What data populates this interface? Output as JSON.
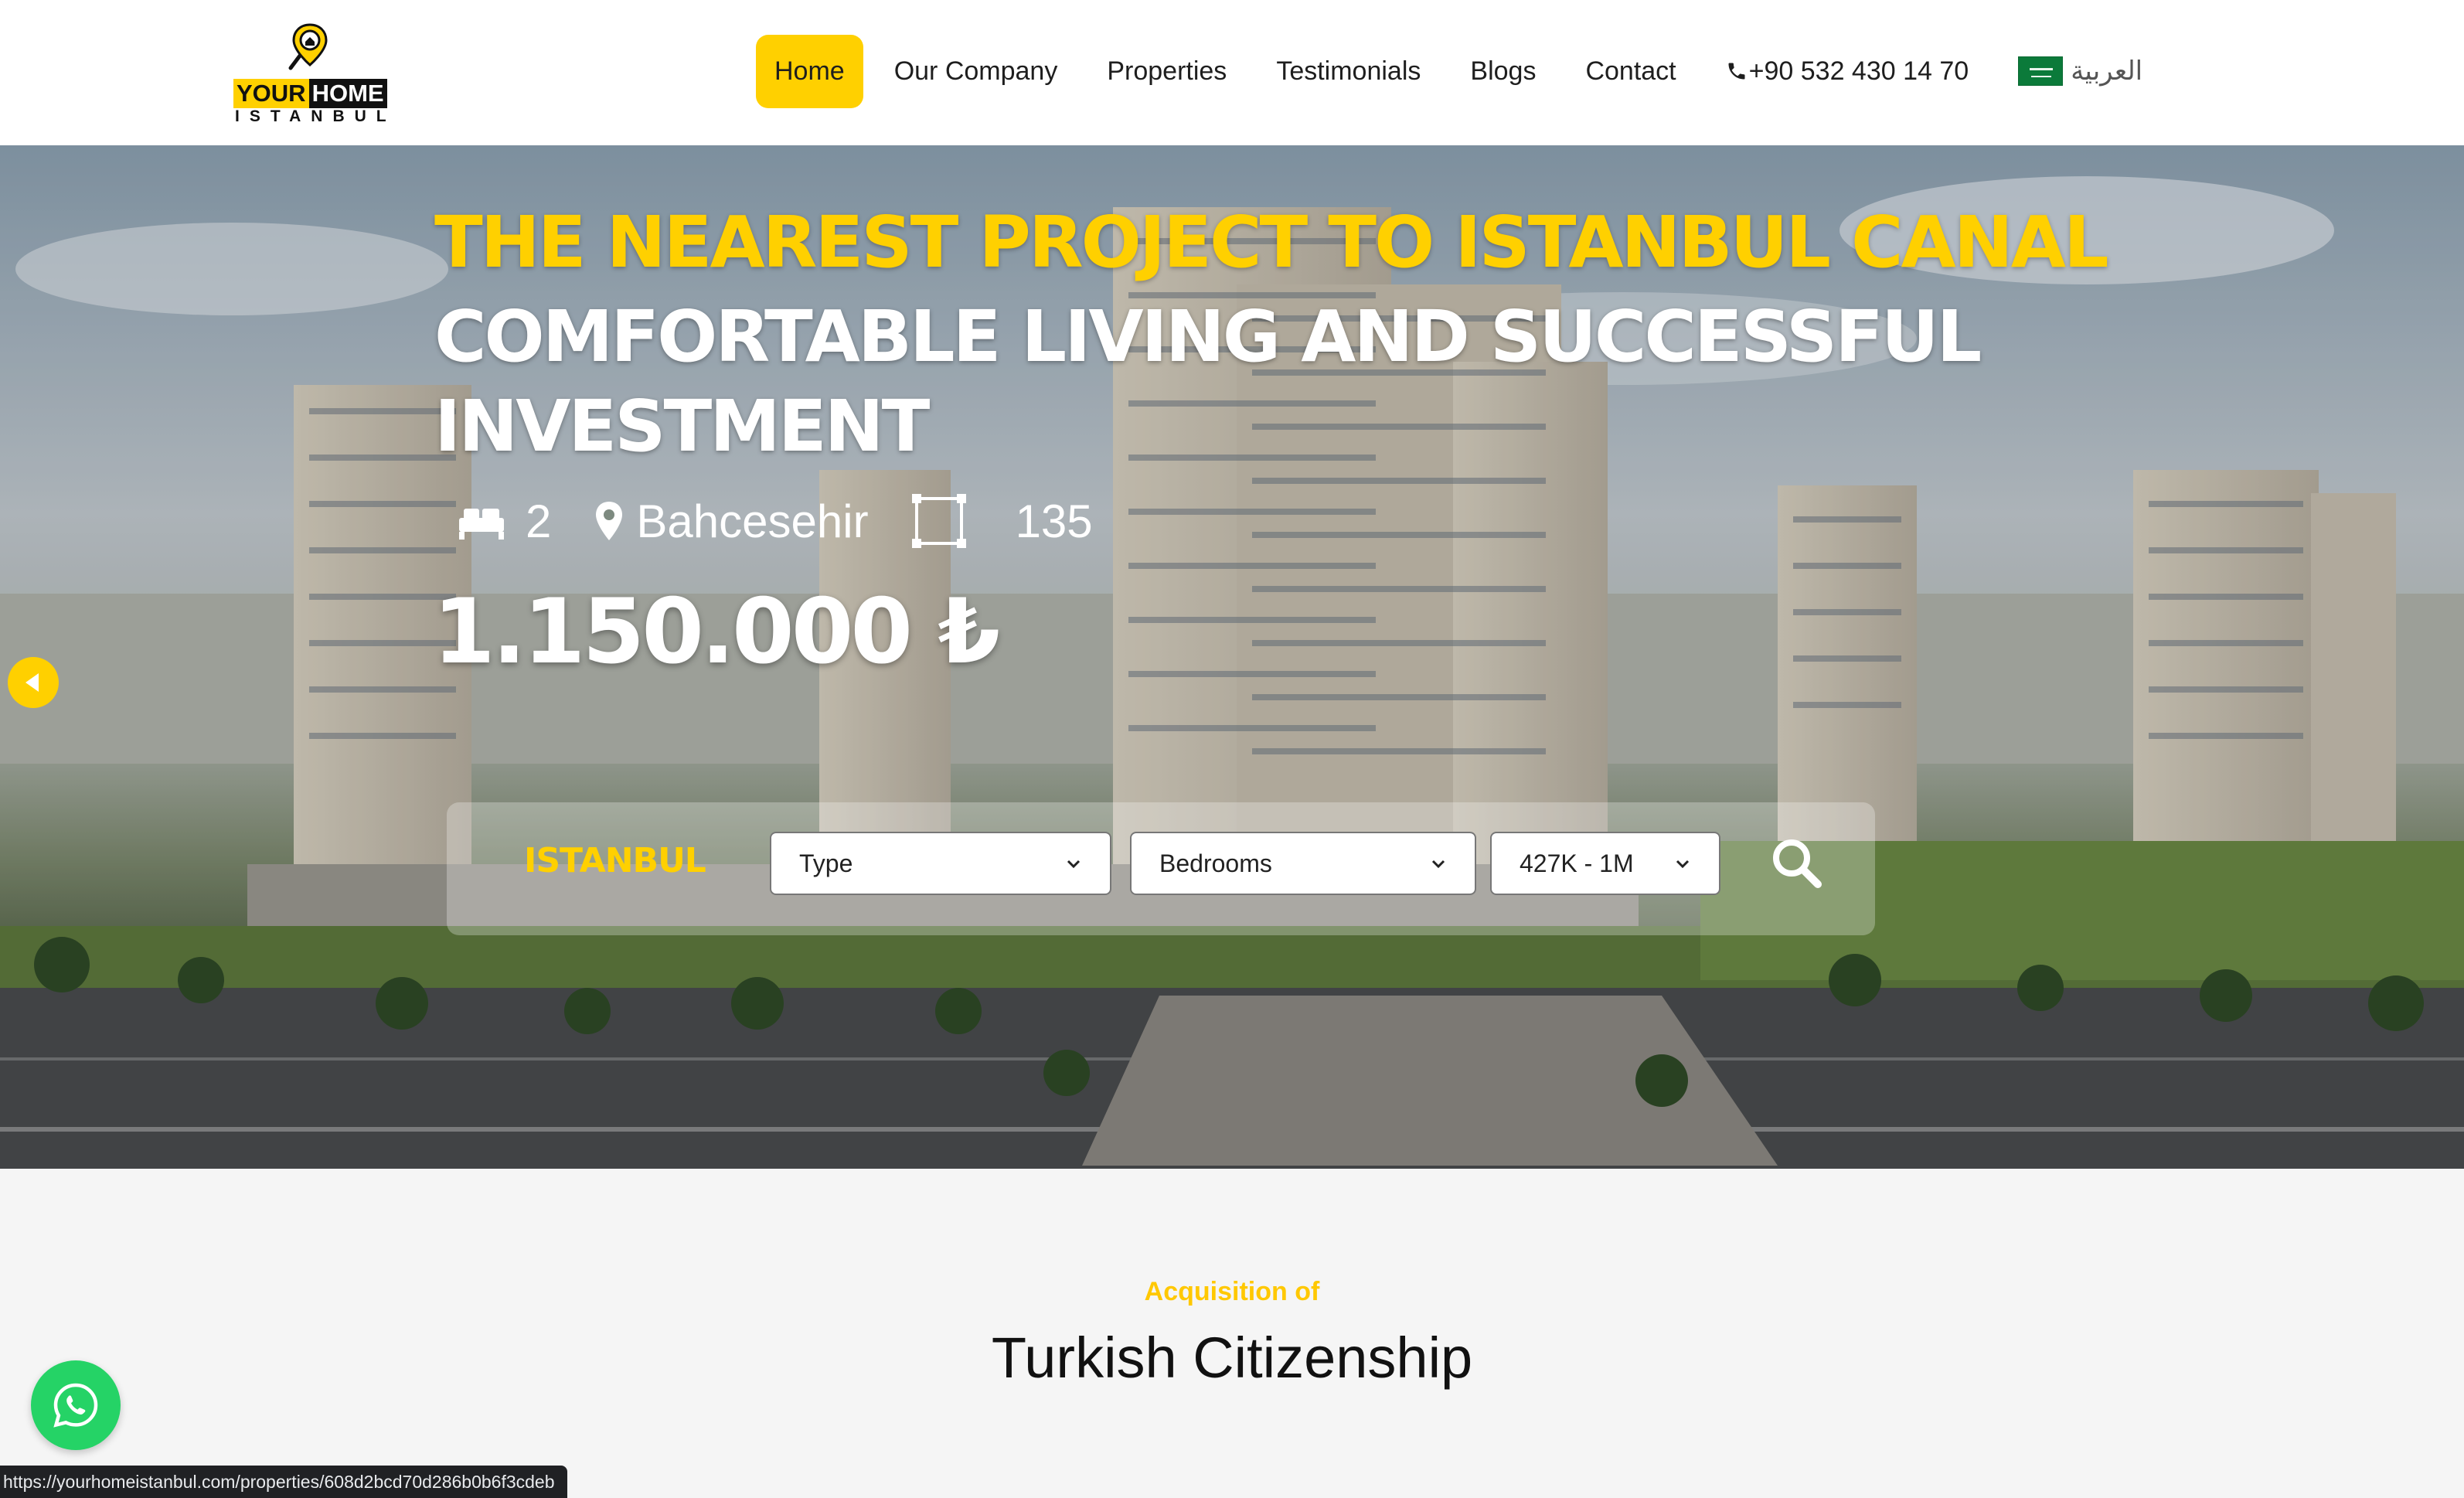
{
  "logo": {
    "word_your": "YOUR",
    "word_home": "HOME",
    "word_city": "ISTANBUL"
  },
  "nav": {
    "items": [
      {
        "label": "Home",
        "active": true
      },
      {
        "label": "Our Company"
      },
      {
        "label": "Properties"
      },
      {
        "label": "Testimonials"
      },
      {
        "label": "Blogs"
      },
      {
        "label": "Contact"
      }
    ],
    "phone": "+90 532 430 14 70",
    "language": "العربية"
  },
  "hero": {
    "title_line1": "THE NEAREST PROJECT TO ISTANBUL CANAL",
    "title_line2": "COMFORTABLE LIVING AND SUCCESSFUL INVESTMENT",
    "bedrooms": "2",
    "location": "Bahcesehir",
    "area": "135",
    "price": "1.150.000 ₺"
  },
  "search": {
    "city": "ISTANBUL",
    "type_selected": "Type",
    "bedrooms_selected": "Bedrooms",
    "price_selected": "427K - 1M"
  },
  "section": {
    "eyebrow": "Acquisition of",
    "title": "Turkish Citizenship"
  },
  "status_bar": {
    "url": "https://yourhomeistanbul.com/properties/608d2bcd70d286b0b6f3cdeb"
  },
  "colors": {
    "accent": "#ffd000",
    "whatsapp": "#25d366",
    "header_bg": "#ffffff",
    "section_bg": "#f5f5f5"
  },
  "icons": {
    "logo_pin": "magnifier-house-pin-icon",
    "phone": "phone-icon",
    "flag": "saudi-flag-icon",
    "bed": "bed-icon",
    "location": "map-pin-icon",
    "area": "area-square-icon",
    "prev": "chevron-left-icon",
    "search": "search-icon",
    "whatsapp": "whatsapp-icon"
  }
}
